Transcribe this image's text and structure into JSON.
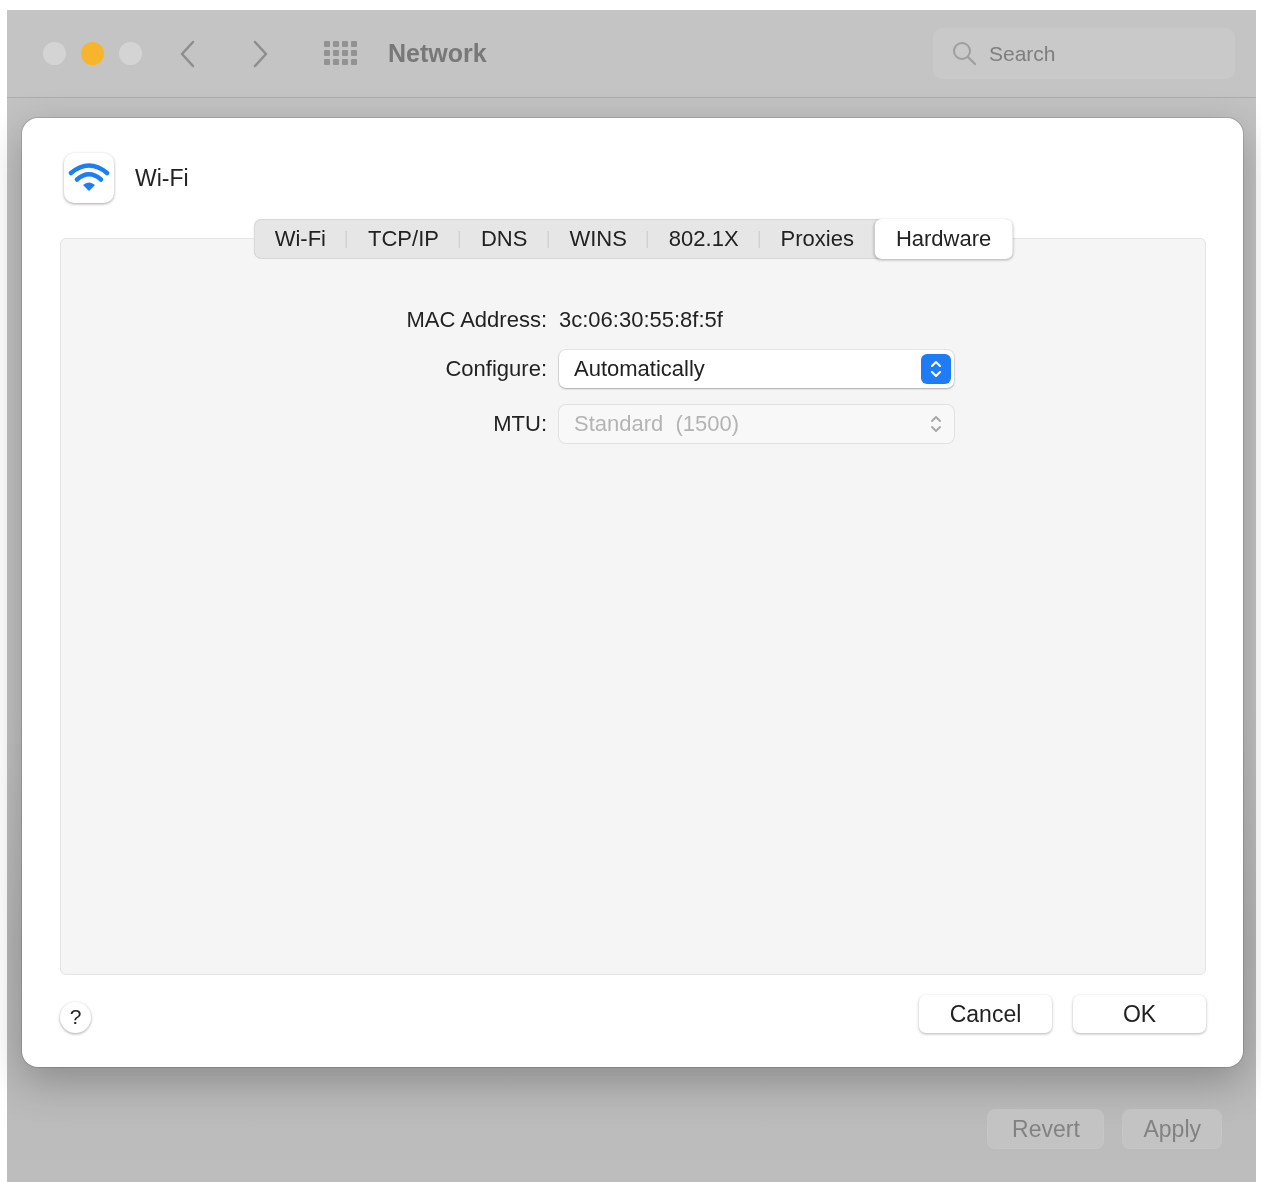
{
  "window": {
    "title": "Network",
    "search": {
      "placeholder": "Search"
    },
    "traffic_lights": [
      {
        "color": "#d4d4d4"
      },
      {
        "color": "#f7b52c"
      },
      {
        "color": "#d4d4d4"
      }
    ],
    "footer_buttons": [
      {
        "label": "Revert",
        "disabled": true
      },
      {
        "label": "Apply",
        "disabled": true
      }
    ]
  },
  "sheet": {
    "title": "Wi-Fi",
    "tabs": [
      {
        "label": "Wi-Fi",
        "selected": false
      },
      {
        "label": "TCP/IP",
        "selected": false
      },
      {
        "label": "DNS",
        "selected": false
      },
      {
        "label": "WINS",
        "selected": false
      },
      {
        "label": "802.1X",
        "selected": false
      },
      {
        "label": "Proxies",
        "selected": false
      },
      {
        "label": "Hardware",
        "selected": true
      }
    ],
    "fields": [
      {
        "kind": "text",
        "label": "MAC Address:",
        "value": "3c:06:30:55:8f:5f"
      },
      {
        "kind": "popup",
        "label": "Configure:",
        "value": "Automatically",
        "disabled": false
      },
      {
        "kind": "popup",
        "label": "MTU:",
        "value": "Standard  (1500)",
        "disabled": true
      }
    ],
    "help": "?",
    "buttons": [
      "Cancel",
      "OK"
    ]
  }
}
